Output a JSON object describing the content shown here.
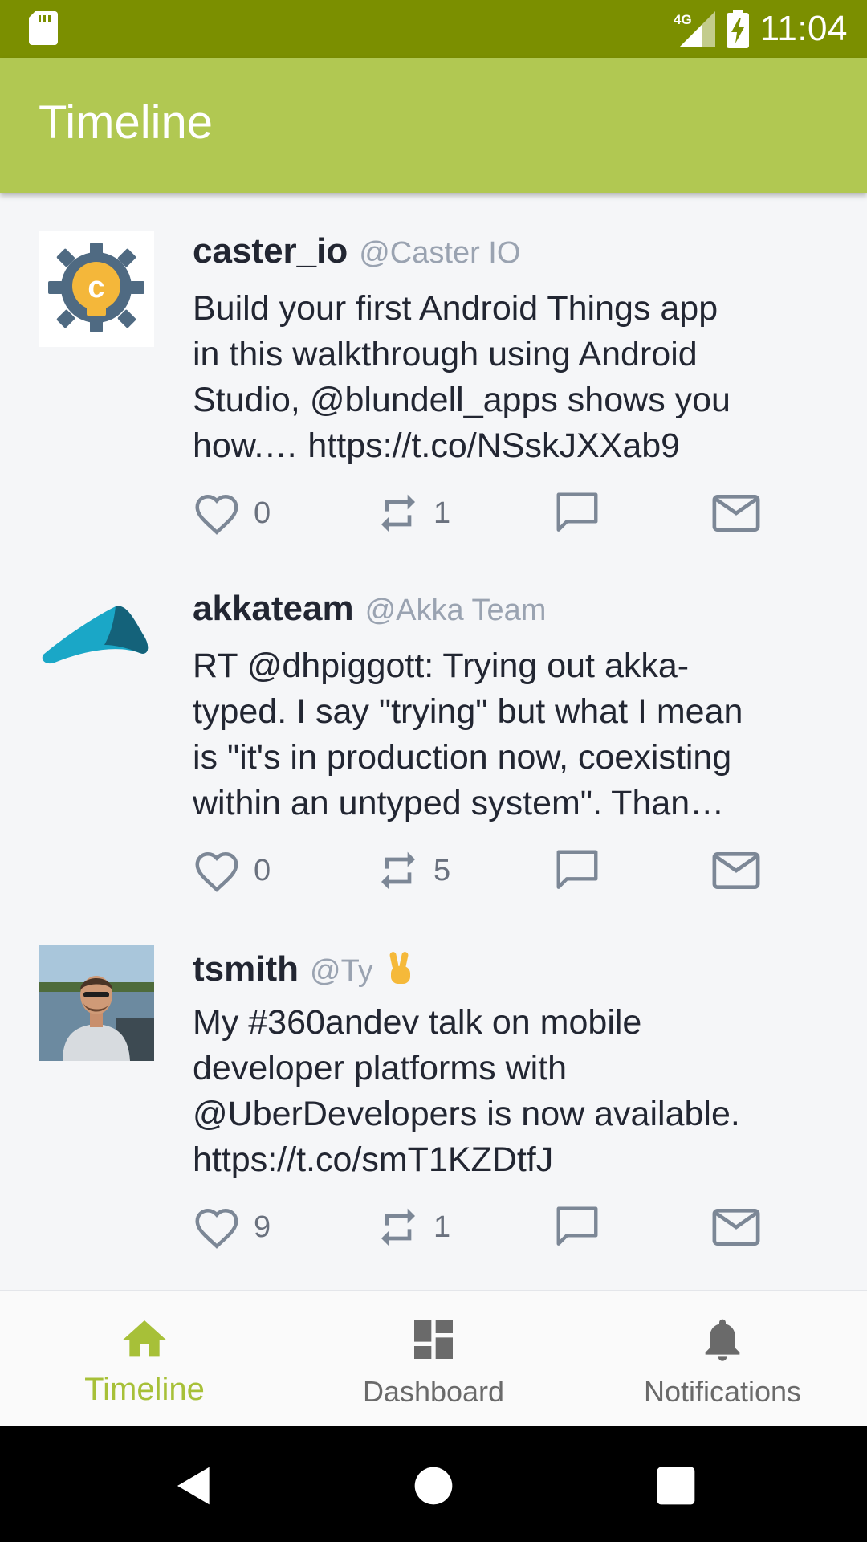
{
  "status_bar": {
    "time": "11:04",
    "network": "4G",
    "colors": {
      "background": "#7b8f00"
    }
  },
  "app_bar": {
    "title": "Timeline",
    "color": "#b1c852"
  },
  "tweets": [
    {
      "username": "caster_io",
      "handle": "@Caster IO",
      "text": "Build your first Android Things app\nin this walkthrough using Android\nStudio, @blundell_apps shows you\nhow.… https://t.co/NSskJXXab9",
      "likes": "0",
      "retweets": "1",
      "avatar_icon": "caster-io-logo-icon"
    },
    {
      "username": "akkateam",
      "handle": "@Akka Team",
      "text": "RT @dhpiggott: Trying out akka-\ntyped. I say \"trying\" but what I mean\nis \"it's in production now, coexisting\nwithin an untyped system\". Than…",
      "likes": "0",
      "retweets": "5",
      "avatar_icon": "akka-logo-icon"
    },
    {
      "username": "tsmith",
      "handle": "@Ty",
      "text": "My #360andev talk on mobile\ndeveloper platforms with\n@UberDevelopers is now available.\nhttps://t.co/smT1KZDtfJ",
      "likes": "9",
      "retweets": "1",
      "avatar_icon": "profile-photo"
    }
  ],
  "bottom_nav": {
    "items": [
      {
        "label": "Timeline",
        "icon": "home-icon",
        "active": true
      },
      {
        "label": "Dashboard",
        "icon": "dashboard-icon",
        "active": false
      },
      {
        "label": "Notifications",
        "icon": "bell-icon",
        "active": false
      }
    ],
    "active_color": "#a7c038"
  }
}
